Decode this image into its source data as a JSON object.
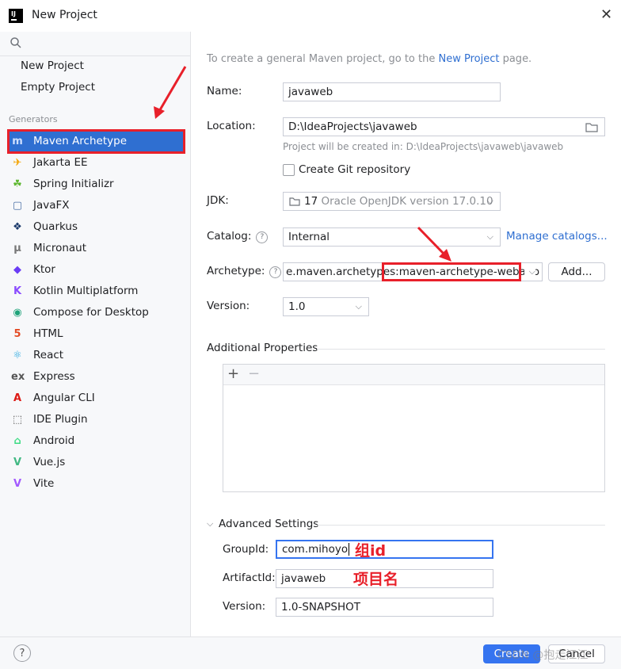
{
  "window": {
    "title": "New Project",
    "icon_text": "IJ"
  },
  "left_panel": {
    "top_items": [
      "New Project",
      "Empty Project"
    ],
    "generators_label": "Generators",
    "generators": [
      {
        "label": "Maven Archetype",
        "icon": "maven-icon",
        "glyph": "m",
        "color": "#7aa2ff"
      },
      {
        "label": "Jakarta EE",
        "icon": "jakarta-icon",
        "glyph": "✈",
        "color": "#f4a300"
      },
      {
        "label": "Spring Initializr",
        "icon": "spring-icon",
        "glyph": "☘",
        "color": "#5fb832"
      },
      {
        "label": "JavaFX",
        "icon": "javafx-icon",
        "glyph": "▢",
        "color": "#4a6fa5"
      },
      {
        "label": "Quarkus",
        "icon": "quarkus-icon",
        "glyph": "❖",
        "color": "#1b3a6b"
      },
      {
        "label": "Micronaut",
        "icon": "micronaut-icon",
        "glyph": "μ",
        "color": "#777"
      },
      {
        "label": "Ktor",
        "icon": "ktor-icon",
        "glyph": "◆",
        "color": "#6a3cf5"
      },
      {
        "label": "Kotlin Multiplatform",
        "icon": "kotlin-icon",
        "glyph": "K",
        "color": "#8a4bff"
      },
      {
        "label": "Compose for Desktop",
        "icon": "compose-icon",
        "glyph": "◉",
        "color": "#1fa37a"
      },
      {
        "label": "HTML",
        "icon": "html-icon",
        "glyph": "5",
        "color": "#e34c26"
      },
      {
        "label": "React",
        "icon": "react-icon",
        "glyph": "⚛",
        "color": "#2aa9e0"
      },
      {
        "label": "Express",
        "icon": "express-icon",
        "glyph": "ex",
        "color": "#555"
      },
      {
        "label": "Angular CLI",
        "icon": "angular-icon",
        "glyph": "A",
        "color": "#dd1b16"
      },
      {
        "label": "IDE Plugin",
        "icon": "plugin-icon",
        "glyph": "⬚",
        "color": "#555"
      },
      {
        "label": "Android",
        "icon": "android-icon",
        "glyph": "⌂",
        "color": "#3ddc84"
      },
      {
        "label": "Vue.js",
        "icon": "vue-icon",
        "glyph": "V",
        "color": "#41b883"
      },
      {
        "label": "Vite",
        "icon": "vite-icon",
        "glyph": "V",
        "color": "#a259ff"
      }
    ]
  },
  "form": {
    "intro_prefix": "To create a general Maven project, go to the",
    "intro_link": "New Project",
    "intro_suffix": "page.",
    "name_label": "Name:",
    "name_value": "javaweb",
    "location_label": "Location:",
    "location_value": "D:\\IdeaProjects\\javaweb",
    "location_hint": "Project will be created in: D:\\IdeaProjects\\javaweb\\javaweb",
    "git_label": "Create Git repository",
    "jdk_label": "JDK:",
    "jdk_version": "17",
    "jdk_name": "Oracle OpenJDK version 17.0.10",
    "catalog_label": "Catalog:",
    "catalog_value": "Internal",
    "manage_catalogs": "Manage catalogs...",
    "archetype_label": "Archetype:",
    "archetype_value": "e.maven.archetypes:maven-archetype-webapp",
    "add_button": "Add...",
    "version_label": "Version:",
    "version_value": "1.0",
    "additional_properties": "Additional Properties",
    "advanced_settings": "Advanced Settings",
    "groupid_label": "GroupId:",
    "groupid_value": "com.mihoyo",
    "groupid_note": "组id",
    "artifactid_label": "ArtifactId:",
    "artifactid_value": "javaweb",
    "artifactid_note": "项目名",
    "adv_version_label": "Version:",
    "adv_version_value": "1.0-SNAPSHOT"
  },
  "footer": {
    "help": "?",
    "create_button": "Create",
    "cancel_button": "Cancel",
    "watermark": "CSDN @抱走江江"
  },
  "colors": {
    "accent": "#2f6fd1",
    "annotation_red": "#e8202a"
  }
}
